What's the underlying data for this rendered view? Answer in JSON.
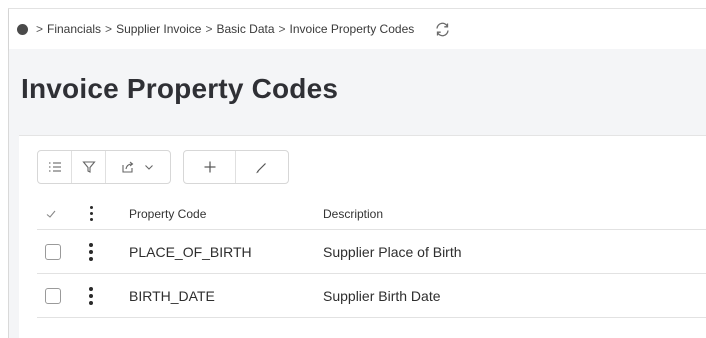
{
  "breadcrumb": {
    "items": [
      "Financials",
      "Supplier Invoice",
      "Basic Data",
      "Invoice Property Codes"
    ]
  },
  "page": {
    "title": "Invoice Property Codes"
  },
  "toolbar": {
    "buttons": [
      "list-view-icon",
      "filter-icon",
      "export-icon",
      "add-icon",
      "edit-icon"
    ]
  },
  "table": {
    "columns": [
      "Property Code",
      "Description"
    ],
    "rows": [
      {
        "code": "PLACE_OF_BIRTH",
        "description": "Supplier Place of Birth"
      },
      {
        "code": "BIRTH_DATE",
        "description": "Supplier Birth Date"
      }
    ]
  },
  "colors": {
    "background": "#f4f5f7",
    "title": "#2f3035"
  }
}
